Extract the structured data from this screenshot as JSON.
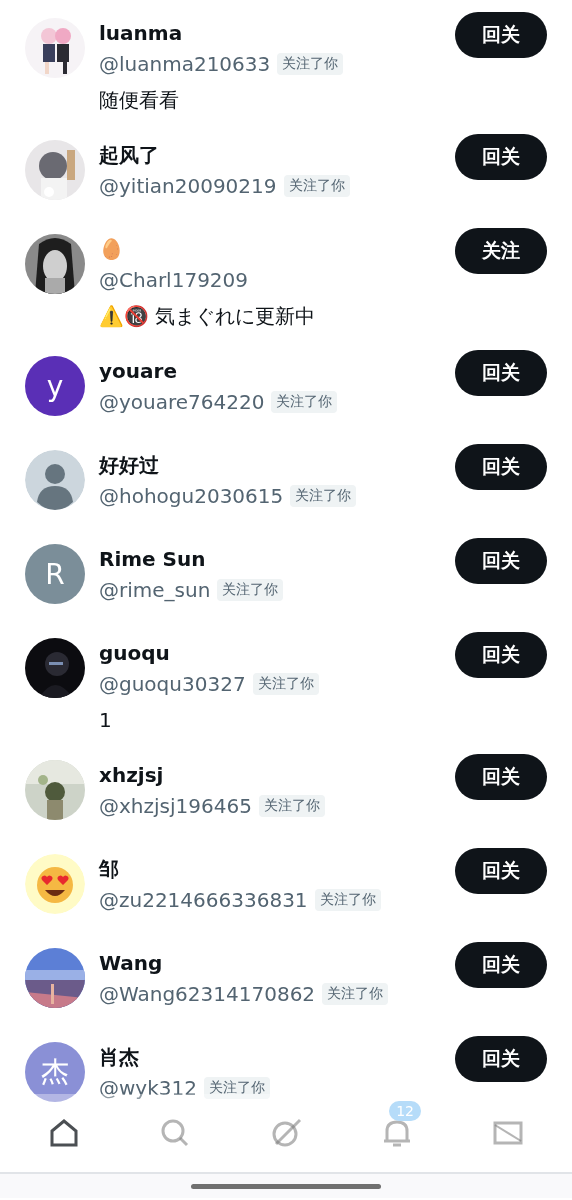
{
  "followers": [
    {
      "name": "luanma",
      "handle": "@luanma210633",
      "badge": "关注了你",
      "bio": "随便看看",
      "button": "回关"
    },
    {
      "name": "起风了",
      "handle": "@yitian20090219",
      "badge": "关注了你",
      "button": "回关"
    },
    {
      "name": "🥚",
      "handle": "@Charl179209",
      "bio": "⚠️🔞 気まぐれに更新中",
      "button": "关注"
    },
    {
      "name": "youare",
      "handle": "@youare764220",
      "badge": "关注了你",
      "button": "回关",
      "avatar": {
        "kind": "letter",
        "letter": "y",
        "color": "#5a2fb6"
      }
    },
    {
      "name": "好好过",
      "handle": "@hohogu2030615",
      "badge": "关注了你",
      "button": "回关",
      "avatar": {
        "kind": "silhouette"
      }
    },
    {
      "name": "Rime Sun",
      "handle": "@rime_sun",
      "badge": "关注了你",
      "button": "回关",
      "avatar": {
        "kind": "letter",
        "letter": "R",
        "color": "#7b8e99"
      }
    },
    {
      "name": "guoqu",
      "handle": "@guoqu30327",
      "badge": "关注了你",
      "bio": "1",
      "button": "回关"
    },
    {
      "name": "xhzjsj",
      "handle": "@xhzjsj196465",
      "badge": "关注了你",
      "button": "回关"
    },
    {
      "name": "邹",
      "handle": "@zu2214666336831",
      "badge": "关注了你",
      "button": "回关",
      "avatar": {
        "kind": "smiley"
      }
    },
    {
      "name": "Wang",
      "handle": "@Wang62314170862",
      "badge": "关注了你",
      "button": "回关"
    },
    {
      "name": "肖杰",
      "handle": "@wyk312",
      "badge": "关注了你",
      "button": "回关",
      "avatar": {
        "kind": "letter",
        "letter": "杰",
        "color": "#8a90d6"
      }
    }
  ],
  "bottom_nav": {
    "items": [
      {
        "kind": "home",
        "selected": true
      },
      {
        "kind": "search",
        "selected": false
      },
      {
        "kind": "slash-circle",
        "selected": false
      },
      {
        "kind": "bell",
        "selected": false,
        "badge": "12"
      },
      {
        "kind": "mail",
        "selected": false
      }
    ]
  }
}
